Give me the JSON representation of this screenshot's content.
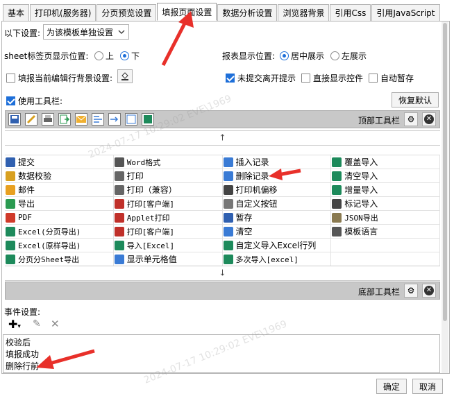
{
  "tabs": [
    "基本",
    "打印机(服务器)",
    "分页预览设置",
    "填报页面设置",
    "数据分析设置",
    "浏览器背景",
    "引用Css",
    "引用JavaScript"
  ],
  "active_tab": "填报页面设置",
  "settings_for": {
    "label": "以下设置:",
    "value": "为该模板单独设置"
  },
  "sheet_pos": {
    "label": "sheet标签页显示位置:",
    "opt1": "上",
    "opt2": "下",
    "selected": "下"
  },
  "report_pos": {
    "label": "报表显示位置:",
    "opt1": "居中展示",
    "opt2": "左展示",
    "selected": "居中展示"
  },
  "row_bg": {
    "label": "填报当前编辑行背景设置:",
    "checked": false
  },
  "unsubmitted": {
    "label": "未提交离开提示",
    "checked": true
  },
  "show_widget": {
    "label": "直接显示控件",
    "checked": false
  },
  "auto_save": {
    "label": "自动暂存",
    "checked": false
  },
  "use_toolbar": {
    "label": "使用工具栏:",
    "checked": true
  },
  "restore_default": "恢复默认",
  "top_toolbar_label": "顶部工具栏",
  "bottom_toolbar_label": "底部工具栏",
  "grid": [
    [
      {
        "t": "提交",
        "i": "save-icon",
        "c": "#3060b0"
      },
      {
        "t": "Word格式",
        "i": "word-icon",
        "c": "#555",
        "m": true
      },
      {
        "t": "插入记录",
        "i": "insert-row-icon",
        "c": "#3a7bd5"
      },
      {
        "t": "覆盖导入",
        "i": "excel-icon",
        "c": "#1d8a5b"
      }
    ],
    [
      {
        "t": "数据校验",
        "i": "pencil-icon",
        "c": "#d8a020"
      },
      {
        "t": "打印",
        "i": "printer-icon",
        "c": "#666"
      },
      {
        "t": "删除记录",
        "i": "delete-row-icon",
        "c": "#3a7bd5"
      },
      {
        "t": "清空导入",
        "i": "excel-icon",
        "c": "#1d8a5b"
      }
    ],
    [
      {
        "t": "邮件",
        "i": "mail-icon",
        "c": "#e8a020"
      },
      {
        "t": "打印（兼容）",
        "i": "printer-icon",
        "c": "#666"
      },
      {
        "t": "打印机偏移",
        "i": "move-icon",
        "c": "#444"
      },
      {
        "t": "增量导入",
        "i": "excel-icon",
        "c": "#1d8a5b"
      }
    ],
    [
      {
        "t": "导出",
        "i": "export-icon",
        "c": "#2a9a50"
      },
      {
        "t": "打印[客户端]",
        "i": "pdf-print-icon",
        "c": "#c0302a",
        "m": true
      },
      {
        "t": "自定义按钮",
        "i": "gear-icon",
        "c": "#777"
      },
      {
        "t": "标记导入",
        "i": "excel-mark-icon",
        "c": "#444"
      }
    ],
    [
      {
        "t": "PDF",
        "i": "pdf-icon",
        "c": "#d03a2a",
        "m": true
      },
      {
        "t": "Applet打印",
        "i": "applet-icon",
        "c": "#c0302a",
        "m": true
      },
      {
        "t": "暂存",
        "i": "save-icon",
        "c": "#3060b0"
      },
      {
        "t": "JSON导出",
        "i": "json-icon",
        "c": "#8a7a50",
        "m": true
      }
    ],
    [
      {
        "t": "Excel(分页导出)",
        "i": "excel-icon",
        "c": "#1d8a5b",
        "m": true
      },
      {
        "t": "打印[客户端]",
        "i": "pdf-print-icon",
        "c": "#c0302a",
        "m": true
      },
      {
        "t": "清空",
        "i": "eraser-icon",
        "c": "#3a7bd5"
      },
      {
        "t": "模板语言",
        "i": "template-icon",
        "c": "#555"
      }
    ],
    [
      {
        "t": "Excel(原样导出)",
        "i": "excel-icon",
        "c": "#1d8a5b",
        "m": true
      },
      {
        "t": "导入[Excel]",
        "i": "excel-icon",
        "c": "#1d8a5b",
        "m": true
      },
      {
        "t": "自定义导入Excel行列",
        "i": "excel-icon",
        "c": "#1d8a5b"
      },
      {
        "t": "",
        "i": "",
        "c": ""
      }
    ],
    [
      {
        "t": "分页分Sheet导出",
        "i": "excel-icon",
        "c": "#1d8a5b",
        "m": true
      },
      {
        "t": "显示单元格值",
        "i": "cell-icon",
        "c": "#3a7bd5"
      },
      {
        "t": "多次导入[excel]",
        "i": "excel-icon",
        "c": "#1d8a5b",
        "m": true
      },
      {
        "t": "",
        "i": "",
        "c": ""
      }
    ]
  ],
  "events": {
    "label": "事件设置:",
    "items": [
      "校验后",
      "填报成功",
      "删除行前"
    ]
  },
  "ok": "确定",
  "cancel": "取消",
  "watermark_text": "2024-07-17 10:29:02 EVE\\1969",
  "colors": {
    "accent": "#1e6fd9",
    "arrow": "#e8302a",
    "toolbar_bg": "#c8c8c8"
  }
}
